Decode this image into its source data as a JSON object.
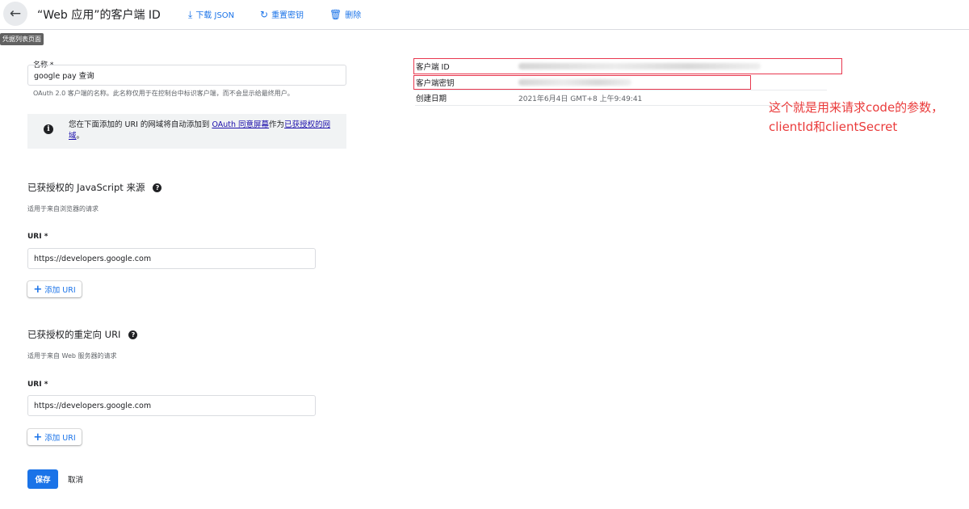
{
  "header": {
    "title": "“Web 应用”的客户端 ID",
    "actions": [
      {
        "icon": "download-icon",
        "label": "下载 JSON"
      },
      {
        "icon": "refresh-icon",
        "label": "重置密钥"
      },
      {
        "icon": "trash-icon",
        "label": "删除"
      }
    ],
    "back_tooltip": "凭据列表页面"
  },
  "name_field": {
    "label": "名称 *",
    "value": "google pay 查询",
    "help": "OAuth 2.0 客户端的名称。此名称仅用于在控制台中标识客户端，而不会显示给最终用户。"
  },
  "info_box": {
    "text_before": "您在下面添加的 URI 的网域将自动添加到",
    "link1": "OAuth 同意屏幕",
    "text_middle": "作为",
    "link2": "已获授权的网域",
    "text_after": "。"
  },
  "js_origins": {
    "title": "已获授权的 JavaScript 来源",
    "subtitle": "适用于来自浏览器的请求",
    "uri_label": "URI *",
    "uri_value": "https://developers.google.com",
    "add_label": "添加 URI"
  },
  "redirect_uris": {
    "title": "已获授权的重定向 URI",
    "subtitle": "适用于来自 Web 服务器的请求",
    "uri_label": "URI *",
    "uri_value": "https://developers.google.com",
    "add_label": "添加 URI"
  },
  "buttons": {
    "save": "保存",
    "cancel": "取消"
  },
  "details": {
    "client_id_label": "客户端 ID",
    "client_secret_label": "客户端密钥",
    "created_label": "创建日期",
    "created_value": "2021年6月4日 GMT+8 上午9:49:41"
  },
  "annotation": {
    "line1": "这个就是用来请求code的参数，",
    "line2": "clientId和clientSecret",
    "color": "#ea3b3b"
  },
  "colors": {
    "accent": "#1a73e8",
    "annotation_red": "#e8384f"
  }
}
